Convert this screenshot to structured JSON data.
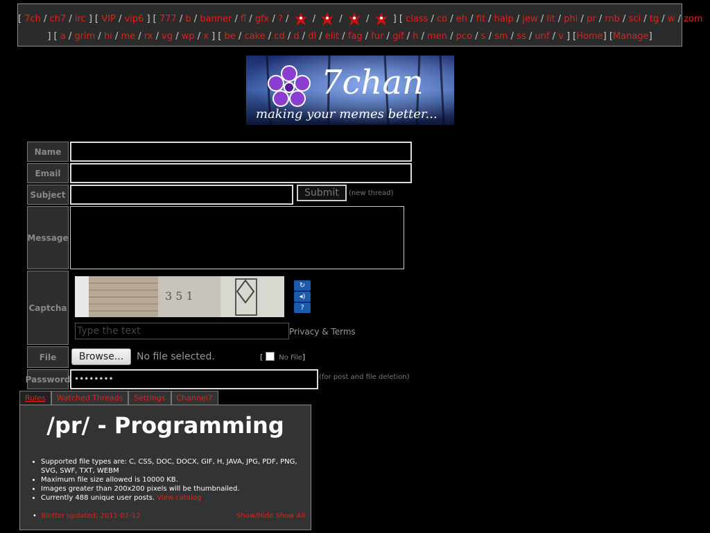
{
  "nav": {
    "row1": [
      "7ch",
      "ch7",
      "irc",
      "VIP",
      "vip6",
      "777",
      "b",
      "banner",
      "fl",
      "gfx",
      "?",
      "class",
      "co",
      "eh",
      "fit",
      "halp",
      "jew",
      "lit",
      "phi",
      "pr",
      "rnb",
      "sci",
      "tg",
      "w",
      "zom"
    ],
    "row2": [
      "a",
      "grim",
      "hi",
      "me",
      "rx",
      "vg",
      "wp",
      "x",
      "be",
      "cake",
      "cd",
      "d",
      "dl",
      "elit",
      "fag",
      "fur",
      "gif",
      "h",
      "men",
      "pco",
      "s",
      "sm",
      "ss",
      "unf",
      "v"
    ],
    "home": "Home",
    "manage": "Manage"
  },
  "banner": {
    "title": "7chan",
    "slogan": "making your memes better..."
  },
  "form": {
    "name_label": "Name",
    "email_label": "Email",
    "subject_label": "Subject",
    "message_label": "Message",
    "captcha_label": "Captcha",
    "file_label": "File",
    "password_label": "Password",
    "submit_label": "Submit",
    "new_thread_note": "(new thread)",
    "captcha_placeholder": "Type the text",
    "privacy_terms": "Privacy & Terms",
    "browse_label": "Browse...",
    "no_file_selected": "No file selected.",
    "no_file_label": "No File",
    "password_value": "••••••••",
    "password_note": "(for post and file deletion)"
  },
  "tabs": [
    "Rules",
    "Watched Threads",
    "Settings",
    "Channel7"
  ],
  "board": {
    "title": "/pr/ - Programming",
    "rules": [
      "Supported file types are: C, CSS, DOC, DOCX, GIF, H, JAVA, JPG, PDF, PNG, SVG, SWF, TXT, WEBM",
      "Maximum file size allowed is 10000 KB.",
      "Images greater than 200x200 pixels will be thumbnailed."
    ],
    "unique_posts": "Currently 488 unique user posts.",
    "view_catalog": "View catalog",
    "blotter": "Blotter updated: 2011-01-12",
    "show_hide": "Show/Hide",
    "show_all": "Show All"
  },
  "colors": {
    "link": "#e0201b",
    "background": "#000000",
    "panel": "#333333"
  }
}
